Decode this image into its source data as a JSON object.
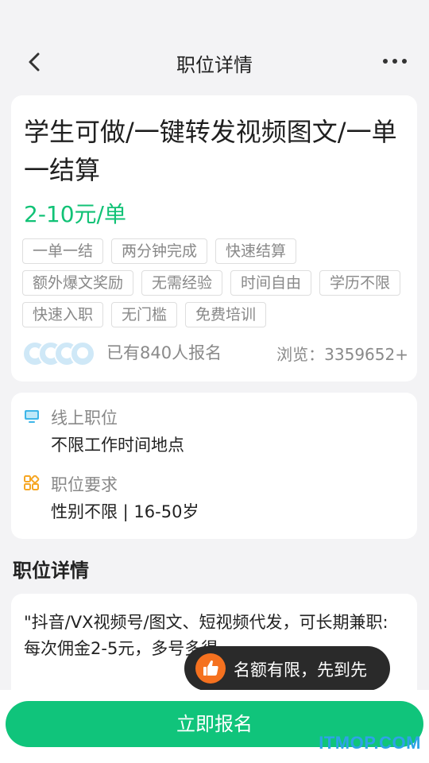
{
  "header": {
    "title": "职位详情",
    "back_icon": "chevron-left-icon",
    "more_icon": "more-icon"
  },
  "job": {
    "title": "学生可做/一键转发视频图文/一单一结算",
    "salary": "2-10元/单",
    "tags": [
      "一单一结",
      "两分钟完成",
      "快速结算",
      "额外爆文奖励",
      "无需经验",
      "时间自由",
      "学历不限",
      "快速入职",
      "无门槛",
      "免费培训"
    ],
    "applied": "已有840人报名",
    "views": "浏览：3359652+"
  },
  "info": {
    "location_label": "线上职位",
    "location_value": "不限工作时间地点",
    "requirement_label": "职位要求",
    "requirement_value": "性别不限 | 16-50岁"
  },
  "section": {
    "title": "职位详情"
  },
  "description": {
    "text": "\"抖音/VX视频号/图文、短视频代发，可长期兼职:\n每次佣金2-5元，多号多得"
  },
  "tooltip": {
    "text": "名额有限，先到先"
  },
  "footer": {
    "apply_label": "立即报名"
  },
  "watermark": "ITMOP.COM",
  "colors": {
    "accent": "#10c47b",
    "salary": "#11c276",
    "tooltip_bg": "#2a2a2a",
    "thumb": "#f5711f"
  }
}
